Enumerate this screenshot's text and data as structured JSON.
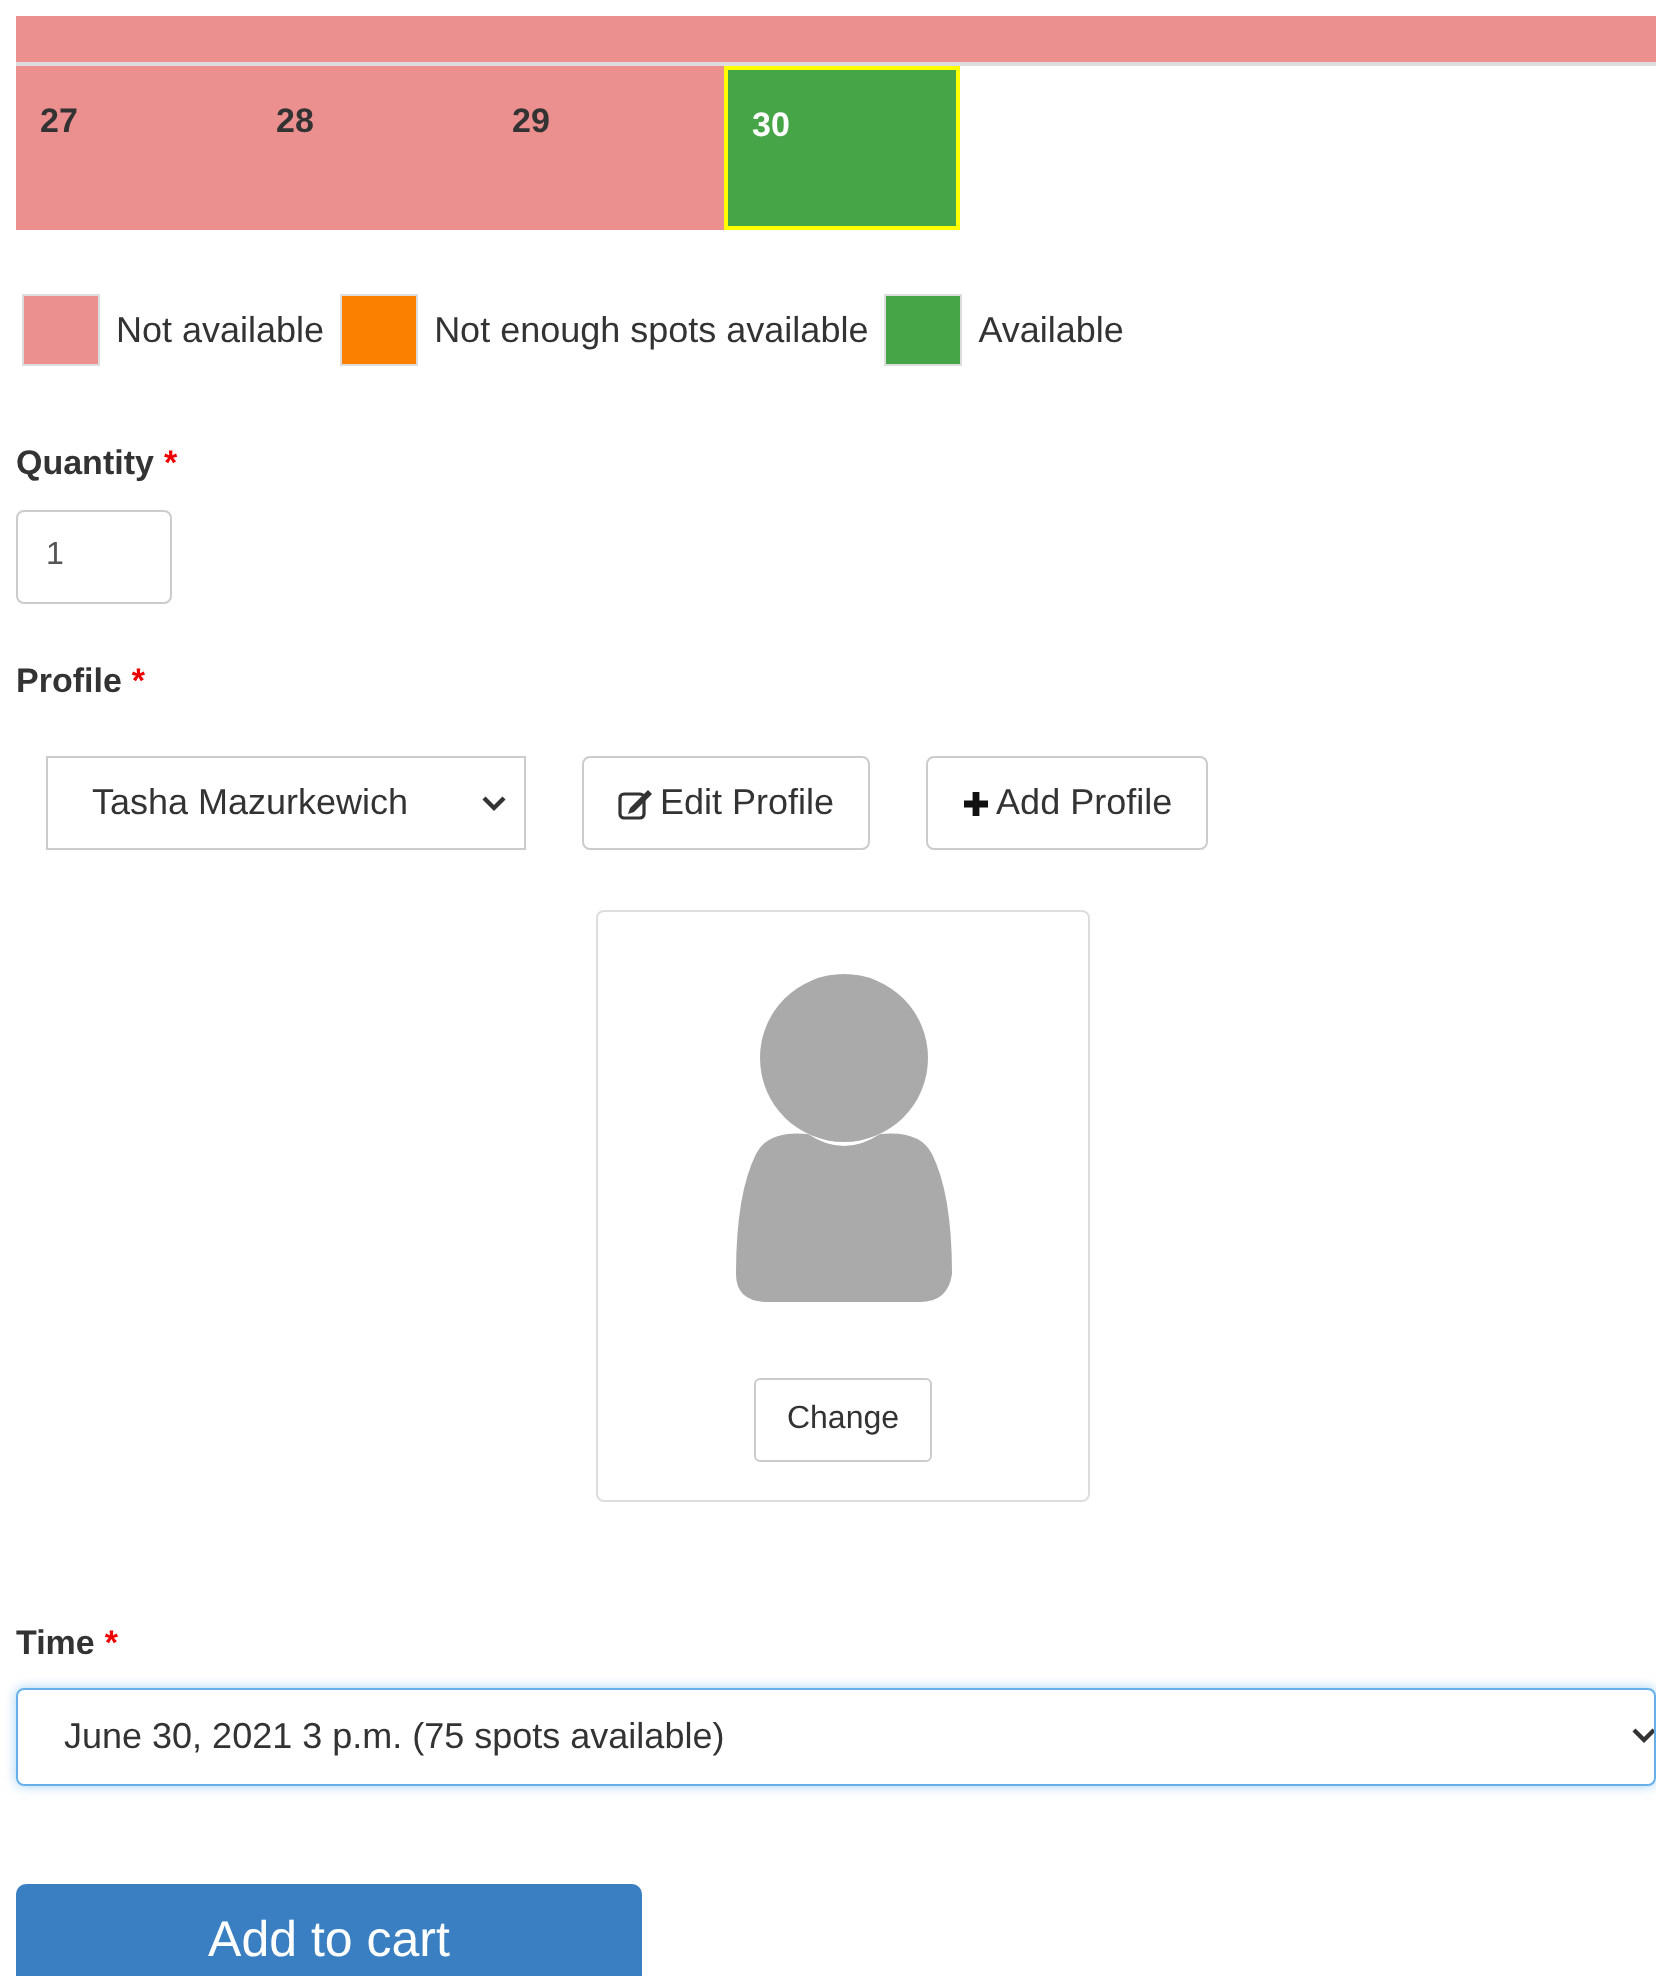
{
  "calendar": {
    "previous_row": {
      "color": "#ec8f8f"
    },
    "days": [
      {
        "label": "27",
        "color": "#ec8f8f",
        "selected": false
      },
      {
        "label": "28",
        "color": "#ec8f8f",
        "selected": false
      },
      {
        "label": "29",
        "color": "#ec8f8f",
        "selected": false
      },
      {
        "label": "30",
        "color": "#46a546",
        "selected": true
      }
    ]
  },
  "legend": [
    {
      "label": "Not available",
      "color": "#ec8f8f"
    },
    {
      "label": "Not enough spots available",
      "color": "#fb8000"
    },
    {
      "label": "Available",
      "color": "#46a546"
    }
  ],
  "quantity": {
    "label": "Quantity",
    "required_mark": "*",
    "value": "1"
  },
  "profile": {
    "label": "Profile",
    "required_mark": "*",
    "value": "Tasha Mazurkewich",
    "buttons": [
      {
        "label": "Edit Profile",
        "kind": "edit"
      },
      {
        "label": "Add Profile",
        "kind": "add"
      }
    ],
    "photo": {
      "button": "Change"
    }
  },
  "time": {
    "label": "Time",
    "required_mark": "*",
    "value": "June 30, 2021 3 p.m. (75 spots available)"
  },
  "submit": "Add to cart"
}
